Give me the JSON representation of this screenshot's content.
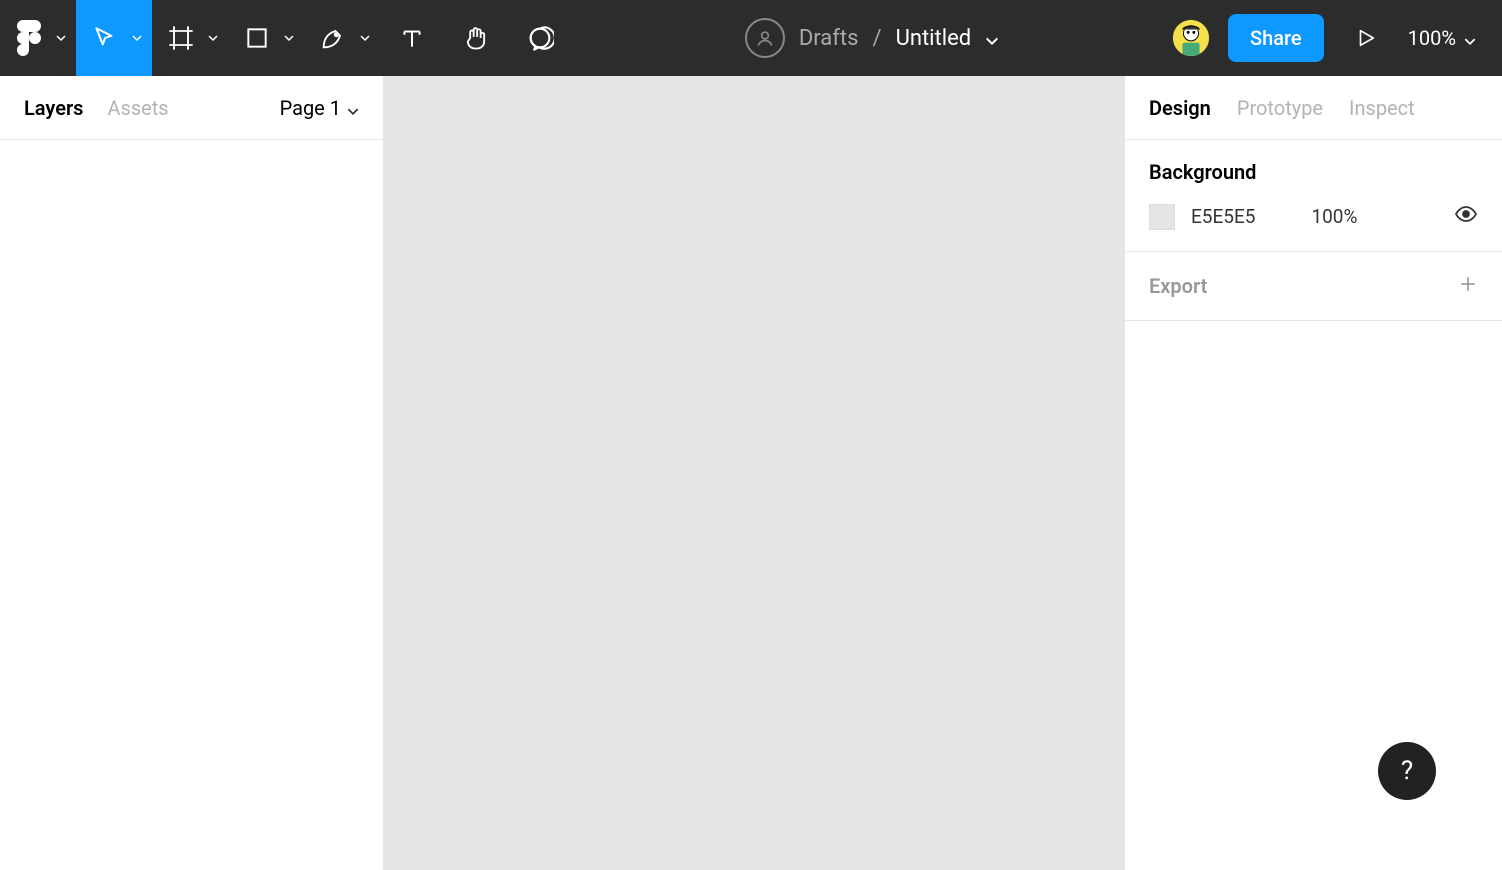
{
  "toolbar": {
    "breadcrumb_folder": "Drafts",
    "breadcrumb_sep": "/",
    "breadcrumb_title": "Untitled",
    "share_label": "Share",
    "zoom": "100%"
  },
  "left_panel": {
    "tabs": {
      "layers": "Layers",
      "assets": "Assets"
    },
    "page_selector": "Page 1"
  },
  "right_panel": {
    "tabs": {
      "design": "Design",
      "prototype": "Prototype",
      "inspect": "Inspect"
    },
    "background": {
      "title": "Background",
      "hex": "E5E5E5",
      "opacity": "100%"
    },
    "export_label": "Export"
  },
  "help_label": "?"
}
